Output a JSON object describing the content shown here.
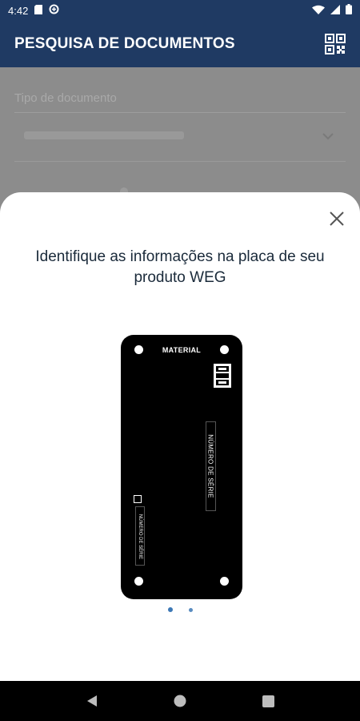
{
  "status_bar": {
    "time": "4:42"
  },
  "app_bar": {
    "title": "PESQUISA DE DOCUMENTOS",
    "qr_icon": "qr-code-icon"
  },
  "form": {
    "document_type_label": "Tipo de documento"
  },
  "sheet": {
    "title": "Identifique as informações na placa de seu produto WEG",
    "plate": {
      "material_label": "MATERIAL",
      "serial_label": "NÚMERO DE SÉRIE",
      "serial_label_small": "NÚMERO DE SÉRIE"
    },
    "pager": {
      "current": 1,
      "total": 2
    }
  },
  "colors": {
    "primary": "#1f3a63",
    "accent": "#3c78b5"
  }
}
